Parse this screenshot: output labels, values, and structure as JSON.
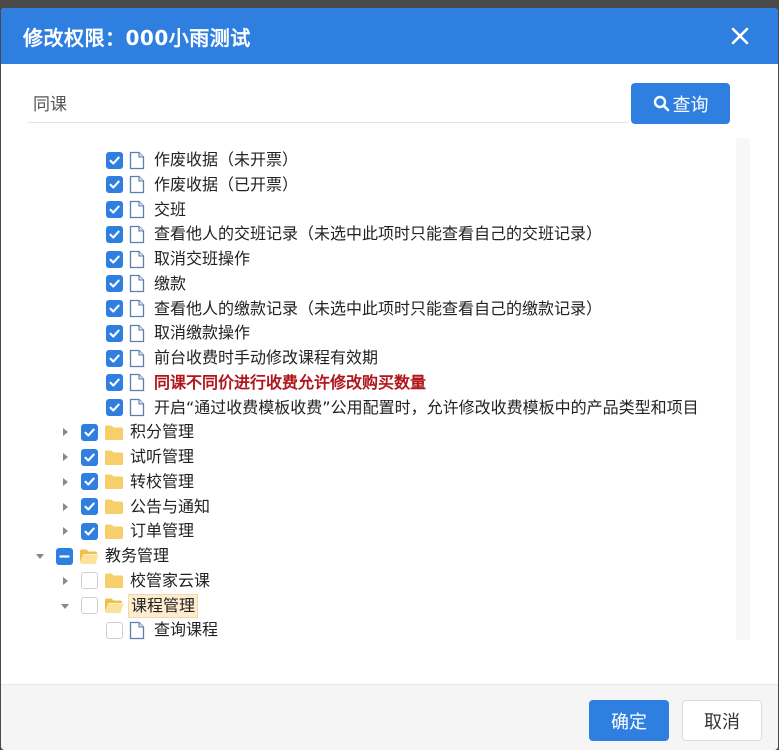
{
  "dialog": {
    "title": "修改权限：000小雨测试",
    "close_icon": "close-icon"
  },
  "search": {
    "value": "同课",
    "button_label": "查询",
    "button_icon": "search-icon"
  },
  "tree": {
    "items": [
      {
        "label": "作废收据（未开票）",
        "level": 3,
        "type": "file",
        "check": "checked",
        "expander": "none",
        "style": "normal"
      },
      {
        "label": "作废收据（已开票）",
        "level": 3,
        "type": "file",
        "check": "checked",
        "expander": "none",
        "style": "normal"
      },
      {
        "label": "交班",
        "level": 3,
        "type": "file",
        "check": "checked",
        "expander": "none",
        "style": "normal"
      },
      {
        "label": "查看他人的交班记录（未选中此项时只能查看自己的交班记录）",
        "level": 3,
        "type": "file",
        "check": "checked",
        "expander": "none",
        "style": "normal"
      },
      {
        "label": "取消交班操作",
        "level": 3,
        "type": "file",
        "check": "checked",
        "expander": "none",
        "style": "normal"
      },
      {
        "label": "缴款",
        "level": 3,
        "type": "file",
        "check": "checked",
        "expander": "none",
        "style": "normal"
      },
      {
        "label": "查看他人的缴款记录（未选中此项时只能查看自己的缴款记录）",
        "level": 3,
        "type": "file",
        "check": "checked",
        "expander": "none",
        "style": "normal"
      },
      {
        "label": "取消缴款操作",
        "level": 3,
        "type": "file",
        "check": "checked",
        "expander": "none",
        "style": "normal"
      },
      {
        "label": "前台收费时手动修改课程有效期",
        "level": 3,
        "type": "file",
        "check": "checked",
        "expander": "none",
        "style": "normal"
      },
      {
        "label": "同课不同价进行收费允许修改购买数量",
        "level": 3,
        "type": "file",
        "check": "checked",
        "expander": "none",
        "style": "highlight"
      },
      {
        "label": "开启“通过收费模板收费”公用配置时，允许修改收费模板中的产品类型和项目",
        "level": 3,
        "type": "file",
        "check": "checked",
        "expander": "none",
        "style": "normal"
      },
      {
        "label": "积分管理",
        "level": 2,
        "type": "folder",
        "check": "checked",
        "expander": "collapsed",
        "style": "normal"
      },
      {
        "label": "试听管理",
        "level": 2,
        "type": "folder",
        "check": "checked",
        "expander": "collapsed",
        "style": "normal"
      },
      {
        "label": "转校管理",
        "level": 2,
        "type": "folder",
        "check": "checked",
        "expander": "collapsed",
        "style": "normal"
      },
      {
        "label": "公告与通知",
        "level": 2,
        "type": "folder",
        "check": "checked",
        "expander": "collapsed",
        "style": "normal"
      },
      {
        "label": "订单管理",
        "level": 2,
        "type": "folder",
        "check": "checked",
        "expander": "collapsed",
        "style": "normal"
      },
      {
        "label": "教务管理",
        "level": 1,
        "type": "folder-open",
        "check": "partial",
        "expander": "expanded",
        "style": "normal"
      },
      {
        "label": "校管家云课",
        "level": 2,
        "type": "folder",
        "check": "empty",
        "expander": "collapsed",
        "style": "normal"
      },
      {
        "label": "课程管理",
        "level": 2,
        "type": "folder-open",
        "check": "empty",
        "expander": "expanded",
        "style": "selected"
      },
      {
        "label": "查询课程",
        "level": 3,
        "type": "file",
        "check": "empty",
        "expander": "none",
        "style": "normal"
      }
    ]
  },
  "footer": {
    "ok_label": "确定",
    "cancel_label": "取消"
  },
  "colors": {
    "primary": "#2f7fe0",
    "highlight_text": "#b0161c",
    "selected_bg": "#fdeccf",
    "folder": "#f6cf6a"
  }
}
